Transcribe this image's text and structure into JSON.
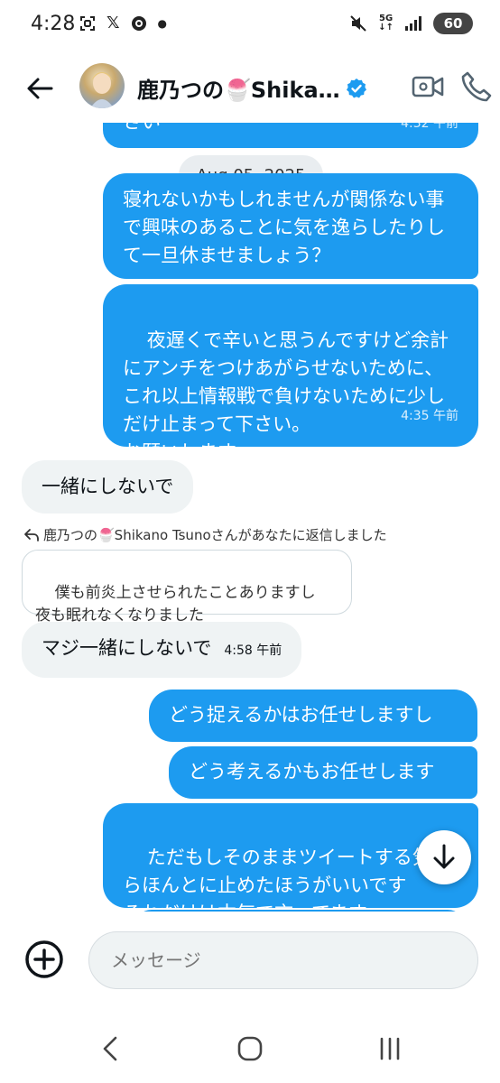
{
  "status_bar": {
    "time": "4:28",
    "network": "5G",
    "battery": "60"
  },
  "header": {
    "title": "鹿乃つの🍧Shika…",
    "icons": [
      "back-arrow-icon",
      "verified-badge-icon",
      "video-call-icon",
      "phone-call-icon"
    ]
  },
  "chat": {
    "date_separator": "Aug 05, 2025",
    "messages": [
      {
        "side": "out",
        "text": "さい",
        "time": "4:32 午前"
      },
      {
        "side": "out",
        "text": "寝れないかもしれませんが関係ない事で興味のあることに気を逸らしたりして一旦休ませましょう？"
      },
      {
        "side": "out",
        "text": "夜遅くで辛いと思うんですけど余計にアンチをつけあがらせないために、これ以上情報戦で負けないために少しだけ止まって下さい。\nお願いします。",
        "time": "4:35 午前"
      },
      {
        "side": "in",
        "text": "一緒にしないで"
      },
      {
        "side": "in",
        "reply_note": "鹿乃つの🍧Shikano Tsunoさんがあなたに返信しました",
        "quoted": "僕も前炎上させられたことありますし\n夜も眠れなくなりました",
        "text": "マジ一緒にしないで",
        "time": "4:58 午前"
      },
      {
        "side": "out",
        "text": "どう捉えるかはお任せしますし"
      },
      {
        "side": "out",
        "text": "どう考えるかもお任せします"
      },
      {
        "side": "out",
        "text": "ただもしそのままツイートする気ならほんとに止めたほうがいいです\nそれだけは本気で言ってます"
      }
    ]
  },
  "composer": {
    "placeholder": "メッセージ"
  },
  "colors": {
    "accent": "#1d9bf0",
    "incoming_bubble": "#eff3f4"
  }
}
